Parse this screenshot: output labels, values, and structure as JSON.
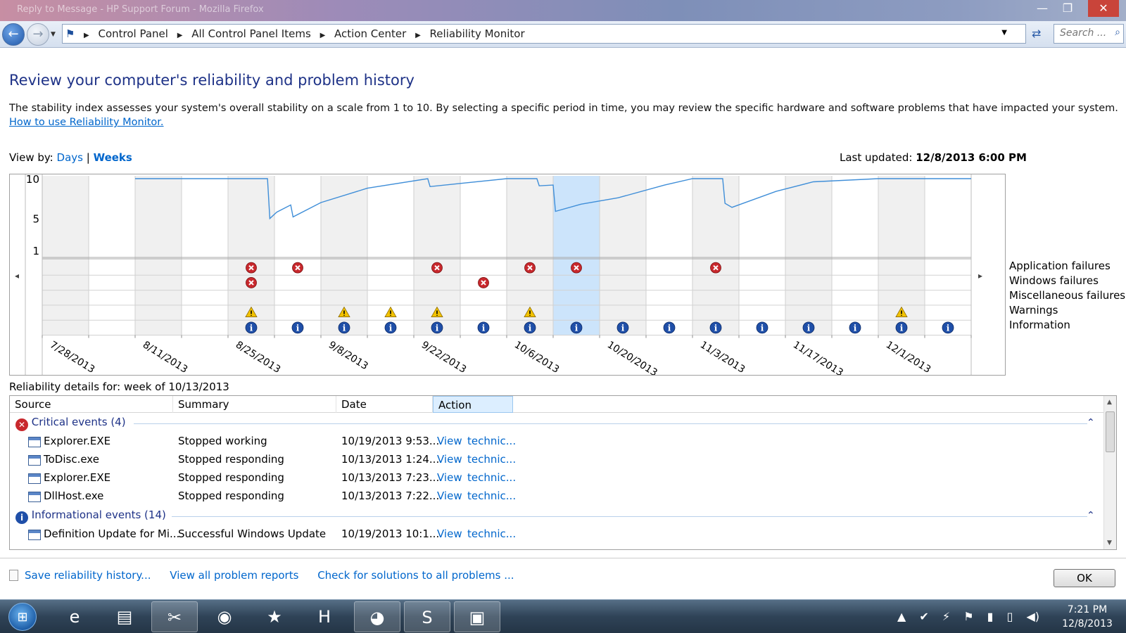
{
  "window": {
    "title": "Reply to Message - HP Support Forum - Mozilla Firefox",
    "minimize_glyph": "—",
    "maximize_glyph": "❐",
    "close_glyph": "✕"
  },
  "nav": {
    "back_glyph": "←",
    "forward_glyph": "→",
    "breadcrumbs": [
      "Control Panel",
      "All Control Panel Items",
      "Action Center",
      "Reliability Monitor"
    ],
    "search_placeholder": "Search ...",
    "icons": [
      "back-arrow-icon",
      "forward-arrow-icon",
      "control-panel-flag-icon",
      "refresh-icon",
      "search-icon"
    ]
  },
  "page": {
    "title": "Review your computer's reliability and problem history",
    "description": "The stability index assesses your system's overall stability on a scale from 1 to 10. By selecting a specific period in time, you may review the specific hardware and software problems that have impacted your system.",
    "help_link": "How to use Reliability Monitor.",
    "view_by_label": "View by:",
    "view_days": "Days",
    "view_sep": "|",
    "view_weeks": "Weeks",
    "last_updated_label": "Last updated:",
    "last_updated_value": "12/8/2013 6:00 PM"
  },
  "chart_data": {
    "type": "line",
    "y_ticks": [
      10,
      5,
      1
    ],
    "ylim": [
      1,
      10
    ],
    "x_labels": [
      "7/28/2013",
      "8/11/2013",
      "8/25/2013",
      "9/8/2013",
      "9/22/2013",
      "10/6/2013",
      "10/20/2013",
      "11/3/2013",
      "11/17/2013",
      "12/1/2013"
    ],
    "num_columns": 20,
    "selected_column": 11,
    "shaded_columns": [
      0,
      2,
      4,
      6,
      8,
      10,
      12,
      14,
      16,
      18
    ],
    "stability_line": [
      [
        2,
        10
      ],
      [
        4.85,
        10
      ],
      [
        4.9,
        5.0
      ],
      [
        5.05,
        5.8
      ],
      [
        5.35,
        6.7
      ],
      [
        5.4,
        5.2
      ],
      [
        6.0,
        7.0
      ],
      [
        7.0,
        8.8
      ],
      [
        8.3,
        10
      ],
      [
        8.35,
        9.0
      ],
      [
        9.0,
        9.4
      ],
      [
        10.0,
        10
      ],
      [
        10.65,
        10
      ],
      [
        10.7,
        9.1
      ],
      [
        11.0,
        9.2
      ],
      [
        11.05,
        5.9
      ],
      [
        11.6,
        6.8
      ],
      [
        12.4,
        7.6
      ],
      [
        13.4,
        9.2
      ],
      [
        14.0,
        10
      ],
      [
        14.65,
        10
      ],
      [
        14.7,
        6.9
      ],
      [
        14.85,
        6.4
      ],
      [
        15.8,
        8.4
      ],
      [
        16.6,
        9.6
      ],
      [
        18.0,
        10
      ],
      [
        20.0,
        10
      ]
    ],
    "rows": [
      "Application failures",
      "Windows failures",
      "Miscellaneous failures",
      "Warnings",
      "Information"
    ],
    "events": {
      "Application failures": [
        4,
        5,
        8,
        10,
        11,
        14
      ],
      "Windows failures": [
        4,
        9
      ],
      "Miscellaneous failures": [],
      "Warnings": [
        4,
        6,
        7,
        8,
        10,
        18
      ],
      "Information": [
        4,
        5,
        6,
        7,
        8,
        9,
        10,
        11,
        12,
        13,
        14,
        15,
        16,
        17,
        18,
        19
      ]
    },
    "scroll_left_glyph": "◂",
    "scroll_right_glyph": "▸"
  },
  "details": {
    "label": "Reliability details for: week of 10/13/2013",
    "columns": [
      "Source",
      "Summary",
      "Date",
      "Action"
    ],
    "groups": [
      {
        "title": "Critical events (4)",
        "icon": "error-icon",
        "rows": [
          {
            "source": "Explorer.EXE",
            "summary": "Stopped working",
            "date": "10/19/2013 9:53...",
            "action1": "View",
            "action2": "technic..."
          },
          {
            "source": "ToDisc.exe",
            "summary": "Stopped responding",
            "date": "10/13/2013 1:24...",
            "action1": "View",
            "action2": "technic..."
          },
          {
            "source": "Explorer.EXE",
            "summary": "Stopped responding",
            "date": "10/13/2013 7:23...",
            "action1": "View",
            "action2": "technic..."
          },
          {
            "source": "DllHost.exe",
            "summary": "Stopped responding",
            "date": "10/13/2013 7:22...",
            "action1": "View",
            "action2": "technic..."
          }
        ]
      },
      {
        "title": "Informational events (14)",
        "icon": "info-icon",
        "rows": [
          {
            "source": "Definition Update for Mi...",
            "summary": "Successful Windows Update",
            "date": "10/19/2013 10:1...",
            "action1": "View",
            "action2": "technic..."
          }
        ]
      }
    ],
    "collapse_glyph": "⌃"
  },
  "footer": {
    "save_history": "Save reliability history...",
    "view_reports": "View all problem reports",
    "check_solutions": "Check for solutions to all problems ...",
    "ok": "OK"
  },
  "taskbar": {
    "start_glyph": "⊞",
    "apps": [
      "internet-explorer",
      "file-explorer",
      "snipping-tool",
      "chrome",
      "pokerstars",
      "hp-app",
      "firefox",
      "skype",
      "control-panel"
    ],
    "app_glyphs": [
      "e",
      "▤",
      "✂",
      "◉",
      "★",
      "H",
      "◕",
      "S",
      "▣"
    ],
    "tray_glyphs": [
      "▲",
      "✔",
      "⚡",
      "⚑",
      "▮",
      "▯",
      "◀)"
    ],
    "time": "7:21 PM",
    "date": "12/8/2013"
  },
  "colors": {
    "title_blue": "#1e3287",
    "link_blue": "#0066cc",
    "line_blue": "#3f8ed8",
    "selected_column": "#cce4fb",
    "shaded_column": "#f0f0f0",
    "error_red": "#c8282d",
    "warning_yellow": "#f2c200",
    "info_blue": "#1f4fa8"
  }
}
